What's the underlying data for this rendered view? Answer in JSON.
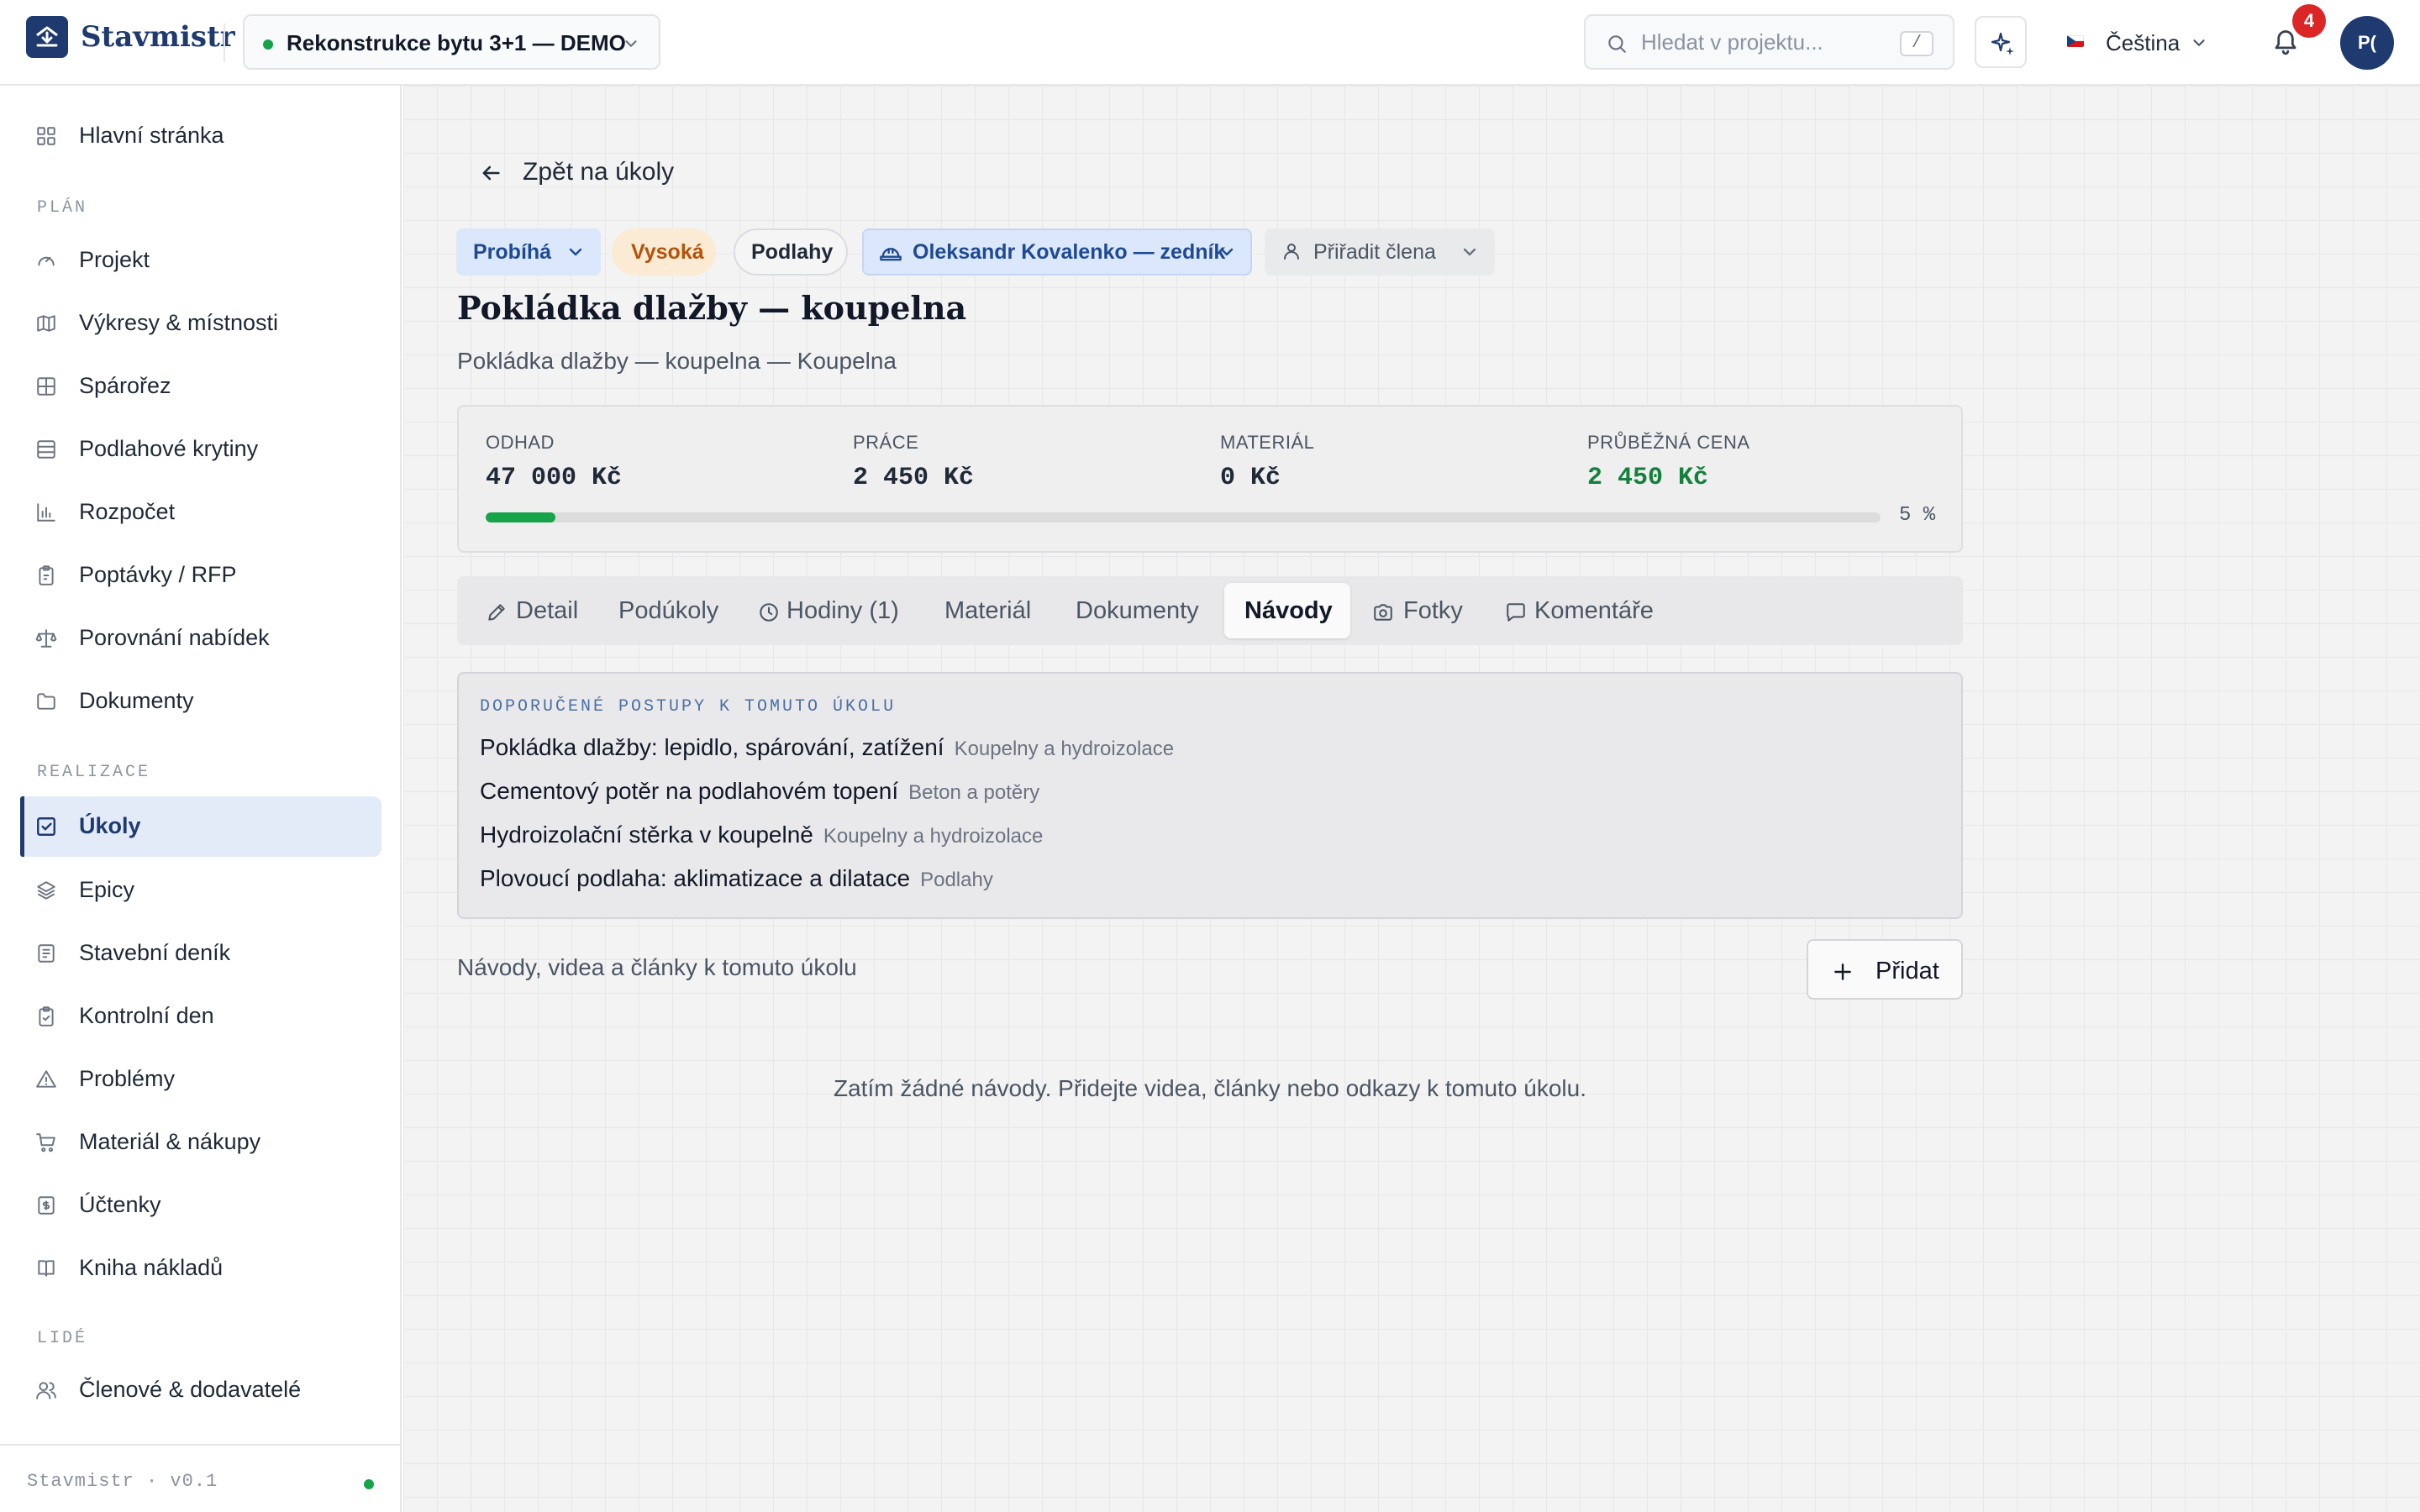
{
  "app": {
    "name": "Stavmistr",
    "version": "Stavmistr · v0.1"
  },
  "topbar": {
    "project": "Rekonstrukce bytu 3+1 — DEMO",
    "search_placeholder": "Hledat v projektu...",
    "search_shortcut": "/",
    "language": "Čeština",
    "notifications": "4",
    "avatar": "P("
  },
  "sidebar": {
    "home": "Hlavní stránka",
    "sections": {
      "plan": "PLÁN",
      "realizace": "REALIZACE",
      "lide": "LIDÉ"
    },
    "plan_items": [
      "Projekt",
      "Výkresy & místnosti",
      "Spárořez",
      "Podlahové krytiny",
      "Rozpočet",
      "Poptávky / RFP",
      "Porovnání nabídek",
      "Dokumenty"
    ],
    "realizace_items": [
      "Úkoly",
      "Epicy",
      "Stavební deník",
      "Kontrolní den",
      "Problémy",
      "Materiál & nákupy",
      "Účtenky",
      "Kniha nákladů"
    ],
    "lide_items": [
      "Členové & dodavatelé"
    ],
    "active": "Úkoly"
  },
  "task": {
    "back_label": "Zpět na úkoly",
    "status": "Probíhá",
    "priority": "Vysoká",
    "category": "Podlahy",
    "assignee": "Oleksandr Kovalenko — zedník",
    "assign_member": "Přiřadit člena",
    "title": "Pokládka dlažby — koupelna",
    "subtitle": "Pokládka dlažby — koupelna — Koupelna"
  },
  "stats": {
    "estimate": {
      "label": "ODHAD",
      "value": "47 000 Kč"
    },
    "labor": {
      "label": "PRÁCE",
      "value": "2 450 Kč"
    },
    "material": {
      "label": "MATERIÁL",
      "value": "0 Kč"
    },
    "running": {
      "label": "PRŮBĚŽNÁ CENA",
      "value": "2 450 Kč"
    },
    "progress_percent": 5,
    "progress_label": "5 %",
    "colors": {
      "progress": "#16a34a",
      "running_value": "#15803d"
    }
  },
  "tabs": [
    "Detail",
    "Podúkoly",
    "Hodiny (1)",
    "Materiál",
    "Dokumenty",
    "Návody",
    "Fotky",
    "Komentáře"
  ],
  "active_tab": "Návody",
  "guides": {
    "heading": "DOPORUČENÉ POSTUPY K TOMUTO ÚKOLU",
    "items": [
      {
        "title": "Pokládka dlažby: lepidlo, spárování, zatížení",
        "category": "Koupelny a hydroizolace"
      },
      {
        "title": "Cementový potěr na podlahovém topení",
        "category": "Beton a potěry"
      },
      {
        "title": "Hydroizolační stěrka v koupelně",
        "category": "Koupelny a hydroizolace"
      },
      {
        "title": "Plovoucí podlaha: aklimatizace a dilatace",
        "category": "Podlahy"
      }
    ]
  },
  "links": {
    "description": "Návody, videa a články k tomuto úkolu",
    "add_label": "Přidat",
    "empty": "Zatím žádné návody. Přidejte videa, články nebo odkazy k tomuto úkolu."
  },
  "icons": {
    "sidebar": [
      "grid-icon",
      "gauge-icon",
      "map-icon",
      "table-icon",
      "layers-list-icon",
      "chart-icon",
      "clipboard-icon",
      "scale-icon",
      "folder-icon",
      "checkbox-icon",
      "stack-icon",
      "notebook-icon",
      "clipboard-check-icon",
      "warning-icon",
      "cart-icon",
      "receipt-icon",
      "book-icon",
      "users-icon"
    ],
    "topbar": [
      "logo-icon",
      "search-icon",
      "sparkle-icon",
      "bell-icon",
      "chevron-down-icon"
    ]
  },
  "theme": {
    "brand": "#1e3a6e",
    "accent_bg": "#e4ebf8",
    "danger": "#dc2626",
    "warning_bg": "#fcebd4"
  }
}
